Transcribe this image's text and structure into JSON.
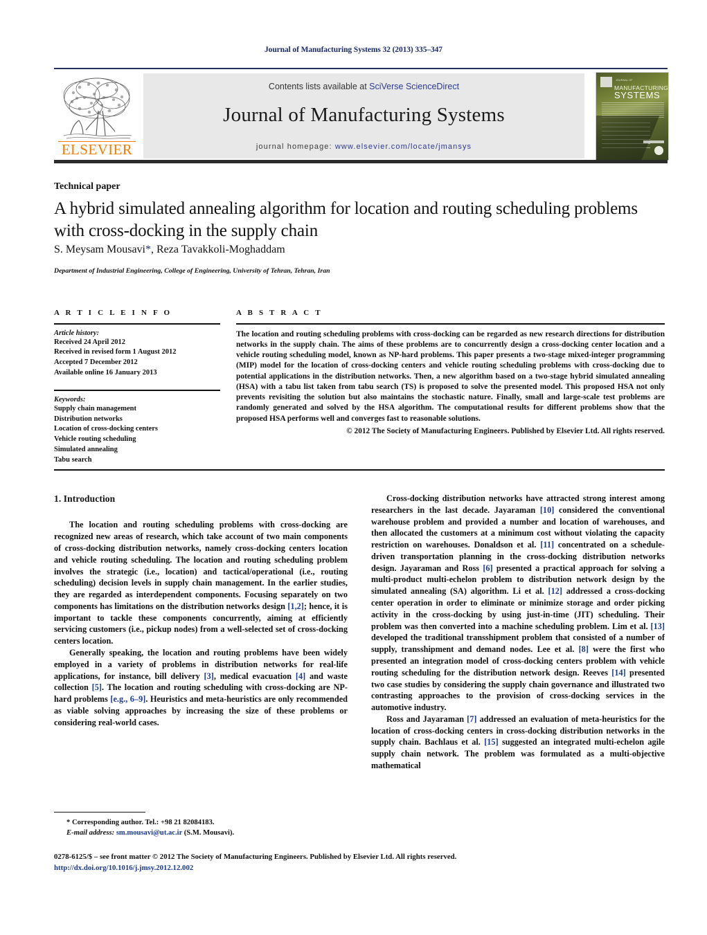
{
  "running_head": "Journal of Manufacturing Systems 32 (2013) 335–347",
  "masthead": {
    "contents_prefix": "Contents lists available at ",
    "contents_link": "SciVerse ScienceDirect",
    "journal_title": "Journal of Manufacturing Systems",
    "homepage_prefix": "journal homepage: ",
    "homepage_url": "www.elsevier.com/locate/jmansys",
    "publisher_wordmark": "ELSEVIER",
    "cover": {
      "eyebrow": "JOURNAL OF",
      "line1": "MANUFACTURING",
      "line2": "SYSTEMS"
    },
    "accent_color": "#2b3a8f",
    "wordmark_color": "#f07d00",
    "band_color": "#e8e8e8"
  },
  "article": {
    "doc_type": "Technical paper",
    "title": "A hybrid simulated annealing algorithm for location and routing scheduling problems with cross-docking in the supply chain",
    "authors": "S. Meysam Mousavi",
    "authors_star": "*",
    "authors_rest": ", Reza Tavakkoli-Moghaddam",
    "affiliation": "Department of Industrial Engineering, College of Engineering, University of Tehran, Tehran, Iran"
  },
  "article_info": {
    "heading": "A R T I C L E   I N F O",
    "history_label": "Article history:",
    "history": [
      "Received 24 April 2012",
      "Received in revised form 1 August 2012",
      "Accepted 7 December 2012",
      "Available online 16 January 2013"
    ],
    "keywords_label": "Keywords:",
    "keywords": [
      "Supply chain management",
      "Distribution networks",
      "Location of cross-docking centers",
      "Vehicle routing scheduling",
      "Simulated annealing",
      "Tabu search"
    ]
  },
  "abstract": {
    "heading": "A B S T R A C T",
    "text": "The location and routing scheduling problems with cross-docking can be regarded as new research directions for distribution networks in the supply chain. The aims of these problems are to concurrently design a cross-docking center location and a vehicle routing scheduling model, known as NP-hard problems. This paper presents a two-stage mixed-integer programming (MIP) model for the location of cross-docking centers and vehicle routing scheduling problems with cross-docking due to potential applications in the distribution networks. Then, a new algorithm based on a two-stage hybrid simulated annealing (HSA) with a tabu list taken from tabu search (TS) is proposed to solve the presented model. This proposed HSA not only prevents revisiting the solution but also maintains the stochastic nature. Finally, small and large-scale test problems are randomly generated and solved by the HSA algorithm. The computational results for different problems show that the proposed HSA performs well and converges fast to reasonable solutions.",
    "copyright": "© 2012 The Society of Manufacturing Engineers. Published by Elsevier Ltd. All rights reserved."
  },
  "body": {
    "section_heading": "1. Introduction",
    "left_paragraphs": [
      "The location and routing scheduling problems with cross-docking are recognized new areas of research, which take account of two main components of cross-docking distribution networks, namely cross-docking centers location and vehicle routing scheduling. The location and routing scheduling problem involves the strategic (i.e., location) and tactical/operational (i.e., routing scheduling) decision levels in supply chain management. In the earlier studies, they are regarded as interdependent components. Focusing separately on two components has limitations on the distribution networks design [1,2]; hence, it is important to tackle these components concurrently, aiming at efficiently servicing customers (i.e., pickup nodes) from a well-selected set of cross-docking centers location.",
      "Generally speaking, the location and routing problems have been widely employed in a variety of problems in distribution networks for real-life applications, for instance, bill delivery [3], medical evacuation [4] and waste collection [5]. The location and routing scheduling with cross-docking are NP-hard problems [e.g., 6–9]. Heuristics and meta-heuristics are only recommended as viable solving approaches by increasing the size of these problems or considering real-world cases."
    ],
    "right_paragraphs": [
      "Cross-docking distribution networks have attracted strong interest among researchers in the last decade. Jayaraman [10] considered the conventional warehouse problem and provided a number and location of warehouses, and then allocated the customers at a minimum cost without violating the capacity restriction on warehouses. Donaldson et al. [11] concentrated on a schedule-driven transportation planning in the cross-docking distribution networks design. Jayaraman and Ross [6] presented a practical approach for solving a multi-product multi-echelon problem to distribution network design by the simulated annealing (SA) algorithm. Li et al. [12] addressed a cross-docking center operation in order to eliminate or minimize storage and order picking activity in the cross-docking by using just-in-time (JIT) scheduling. Their problem was then converted into a machine scheduling problem. Lim et al. [13] developed the traditional transshipment problem that consisted of a number of supply, transshipment and demand nodes. Lee et al. [8] were the first who presented an integration model of cross-docking centers problem with vehicle routing scheduling for the distribution network design. Reeves [14] presented two case studies by considering the supply chain governance and illustrated two contrasting approaches to the provision of cross-docking services in the automotive industry.",
      "Ross and Jayaraman [7] addressed an evaluation of meta-heuristics for the location of cross-docking centers in cross-docking distribution networks in the supply chain. Bachlaus et al. [15] suggested an integrated multi-echelon agile supply chain network. The problem was formulated as a multi-objective mathematical"
    ],
    "reference_color": "#1b3a8f"
  },
  "footnote": {
    "corresponding": "* Corresponding author. Tel.: +98 21 82084183.",
    "email_label": "E-mail address:",
    "email": "sm.mousavi@ut.ac.ir",
    "email_suffix": " (S.M. Mousavi)."
  },
  "bottom": {
    "copyright": "0278-6125/$ – see front matter © 2012 The Society of Manufacturing Engineers. Published by Elsevier Ltd. All rights reserved.",
    "doi": "http://dx.doi.org/10.1016/j.jmsy.2012.12.002"
  }
}
